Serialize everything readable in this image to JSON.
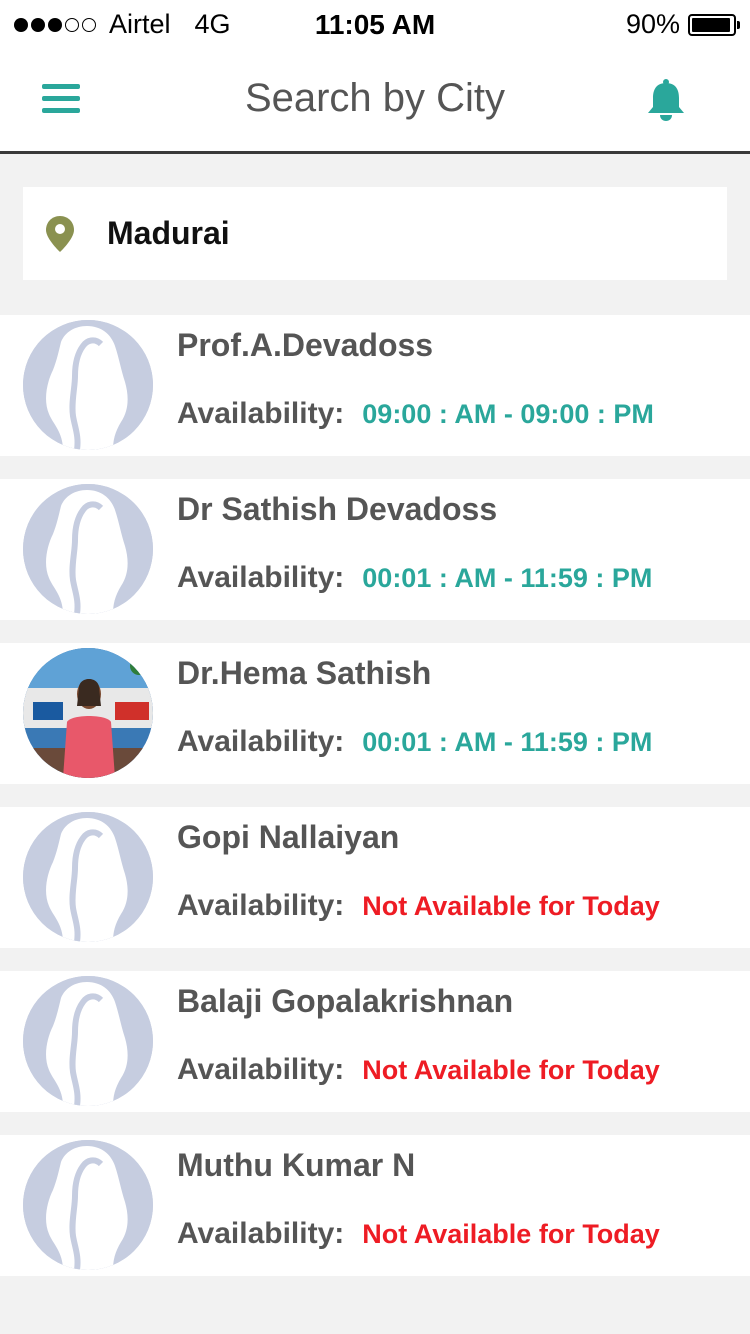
{
  "status_bar": {
    "carrier": "Airtel",
    "network": "4G",
    "time": "11:05 AM",
    "battery": "90%",
    "signal_bars": 3,
    "signal_total": 5,
    "battery_level": 0.9
  },
  "header": {
    "title": "Search by City",
    "menu_icon": "hamburger-menu-icon",
    "notification_icon": "bell-icon",
    "accent_color": "#2aa79b"
  },
  "search": {
    "icon": "location-pin-icon",
    "value": "Madurai",
    "icon_color": "#8a9150"
  },
  "availability_label": "Availability:",
  "doctors": [
    {
      "name": "Prof.A.Devadoss",
      "availability": "09:00 : AM - 09:00 : PM",
      "status": "available",
      "avatar": "placeholder-avatar"
    },
    {
      "name": "Dr Sathish Devadoss",
      "availability": "00:01 : AM - 11:59 : PM",
      "status": "available",
      "avatar": "placeholder-avatar"
    },
    {
      "name": "Dr.Hema Sathish",
      "availability": "00:01 : AM - 11:59 : PM",
      "status": "available",
      "avatar": "photo-avatar"
    },
    {
      "name": "Gopi Nallaiyan",
      "availability": "Not Available for Today",
      "status": "unavailable",
      "avatar": "placeholder-avatar"
    },
    {
      "name": "Balaji Gopalakrishnan",
      "availability": "Not Available for Today",
      "status": "unavailable",
      "avatar": "placeholder-avatar"
    },
    {
      "name": "Muthu Kumar N",
      "availability": "Not Available for Today",
      "status": "unavailable",
      "avatar": "placeholder-avatar"
    }
  ],
  "colors": {
    "available": "#2aa79b",
    "unavailable": "#ee1c24",
    "placeholder_avatar": "#c6cde0"
  }
}
